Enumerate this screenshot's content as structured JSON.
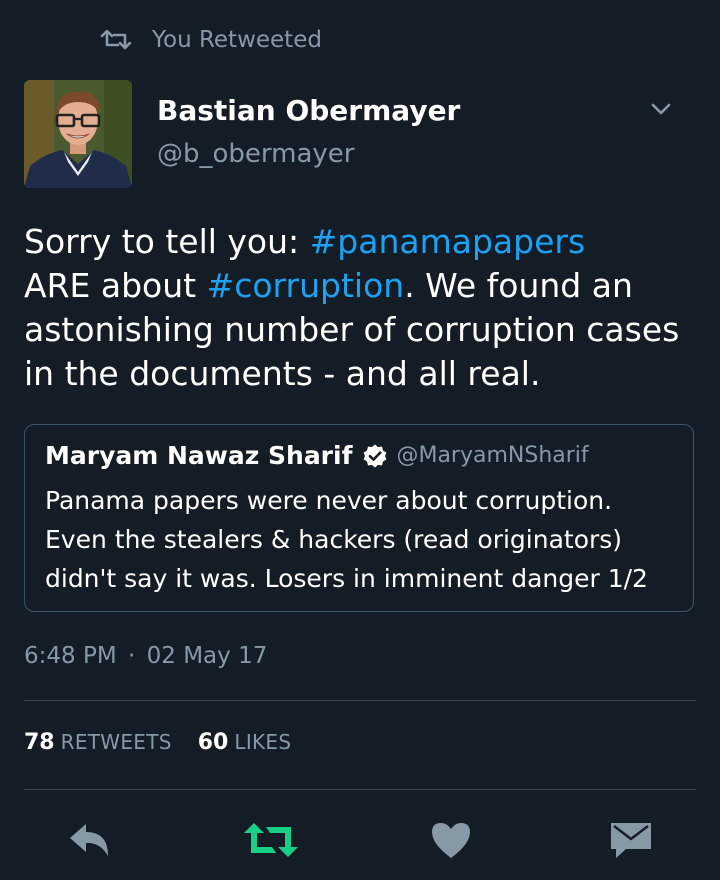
{
  "social_context": {
    "label": "You Retweeted"
  },
  "author": {
    "name": "Bastian Obermayer",
    "handle": "@b_obermayer"
  },
  "tweet": {
    "lines": [
      {
        "before": "Sorry to tell you: ",
        "hashtag": "#panamapapers",
        "after": ""
      },
      {
        "before": "ARE about ",
        "hashtag": "#corruption",
        "after": ". We found an"
      },
      {
        "before": "astonishing number of corruption cases",
        "hashtag": "",
        "after": ""
      },
      {
        "before": "in the documents - and all real.",
        "hashtag": "",
        "after": ""
      }
    ]
  },
  "quoted_tweet": {
    "name": "Maryam Nawaz Sharif",
    "handle": "@MaryamNSharif",
    "lines": [
      "Panama papers were never about corruption.",
      "Even the stealers & hackers (read originators)",
      "didn't say it was. Losers in imminent danger 1/2"
    ]
  },
  "timestamp": {
    "time": "6:48 PM",
    "separator": "·",
    "date": "02 May 17"
  },
  "stats": {
    "retweets_count": "78",
    "retweets_label": "RETWEETS",
    "likes_count": "60",
    "likes_label": "LIKES"
  },
  "colors": {
    "background": "#141d26",
    "link": "#1da1f2",
    "secondary_text": "#8899a6",
    "retweet_active": "#19cf86",
    "action_icon": "#8899a6"
  },
  "icons": {
    "social_context": "retweet-icon",
    "caret": "chevron-down-icon",
    "verified": "verified-badge-icon",
    "reply": "reply-icon",
    "retweet": "retweet-icon",
    "like": "heart-icon",
    "dm": "envelope-icon"
  }
}
